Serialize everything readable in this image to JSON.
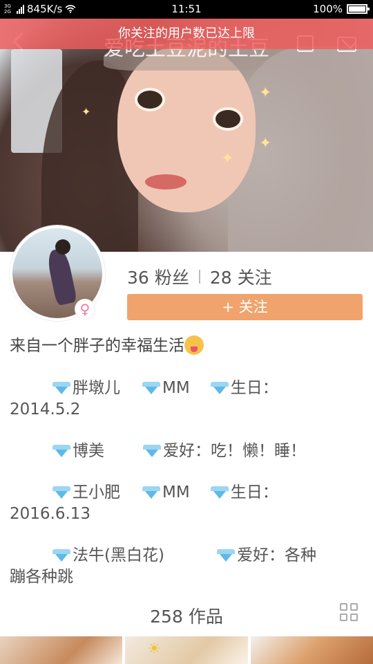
{
  "status_bar": {
    "network_top": "3G",
    "network_bottom": "2G",
    "speed": "845K/s",
    "time": "11:51",
    "battery": "100%"
  },
  "nav": {
    "title": "爱吃土豆泥的土豆",
    "toast": "你关注的用户数已达上限"
  },
  "profile": {
    "fans_count": "36",
    "fans_label": "粉丝",
    "following_count": "28",
    "following_label": "关注",
    "follow_button": "+ 关注",
    "bio": "来自一个胖子的幸福生活"
  },
  "info_lines": [
    {
      "a": "胖墩儿",
      "b": "MM",
      "c": "生日：",
      "tail": "2014.5.2"
    },
    {
      "a": "博美",
      "b": "爱好：吃！懒！睡！"
    },
    {
      "a": "王小肥",
      "b": "MM",
      "c": "生日：",
      "tail": "2016.6.13"
    },
    {
      "a": "法牛(黑白花)",
      "c": "爱好：各种",
      "tail": "蹦各种跳"
    }
  ],
  "works": {
    "count_label": "258 作品"
  },
  "icons": {
    "gem": "diamond-icon",
    "gender": "female-icon",
    "grid": "grid-icon"
  },
  "colors": {
    "toast_bg": "#f05c5c",
    "follow_button_bg": "#f0a36c",
    "gem": "#5fb9e6",
    "female": "#f07aa0"
  }
}
